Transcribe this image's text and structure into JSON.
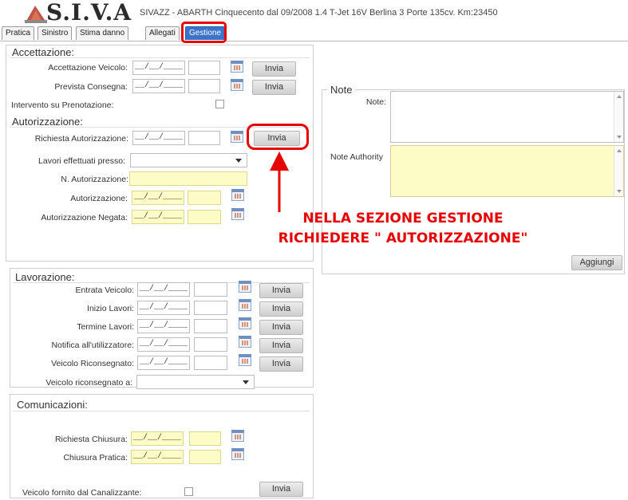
{
  "header": {
    "logo_text": "S.I.V.A",
    "info": "SIVAZZ - ABARTH Cinquecento dal 09/2008 1.4 T-Jet 16V Berlina 3 Porte 135cv. Km:23450"
  },
  "tabs": [
    "Pratica",
    "Sinistro",
    "Stima danno",
    "Allegati",
    "Gestione"
  ],
  "accettazione": {
    "title": "Accettazione:",
    "row1_label": "Accettazione Veicolo:",
    "row2_label": "Prevista Consegna:",
    "check_label": "Intervento su Prenotazione:",
    "date": "__/__/____",
    "send": "Invia"
  },
  "autorizzazione": {
    "title": "Autorizzazione:",
    "richiesta_label": "Richiesta Autorizzazione:",
    "lavori_label": "Lavori effettuati presso:",
    "n_aut_label": "N. Autorizzazione:",
    "aut_label": "Autorizzazione:",
    "negata_label": "Autorizzazione Negata:",
    "date": "__/__/____",
    "send": "Invia"
  },
  "note": {
    "title": "Note",
    "note_label": "Note:",
    "authority_label": "Note Authority",
    "add": "Aggiungi"
  },
  "annotation": {
    "line1": "NELLA SEZIONE GESTIONE",
    "line2": "RICHIEDERE \" AUTORIZZAZIONE\""
  },
  "lavorazione": {
    "title": "Lavorazione:",
    "rows": [
      "Entrata Veicolo:",
      "Inizio Lavori:",
      "Termine Lavori:",
      "Notifica all'utilizzatore:",
      "Veicolo Riconsegnato:"
    ],
    "riconsegnato_a": "Veicolo riconsegnato a:",
    "date": "__/__/____",
    "send": "Invia"
  },
  "comunicazioni": {
    "title": "Comunicazioni:",
    "chiusura_label": "Richiesta Chiusura:",
    "pratica_label": "Chiusura Pratica:",
    "fornito_label": "Veicolo fornito dal Canalizzante:",
    "date": "__/__/____",
    "send": "Invia"
  },
  "colors": {
    "accent": "#3b73c9",
    "annotation": "#e60000",
    "required": "#fdfbc6"
  }
}
